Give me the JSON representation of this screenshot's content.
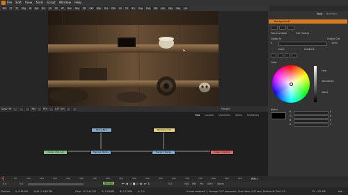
{
  "menu": {
    "items": [
      "File",
      "Edit",
      "View",
      "Tools",
      "Script",
      "Window",
      "Help"
    ]
  },
  "toolbar": {
    "buttons": [
      "BG",
      "FT",
      "TF",
      "Mrg",
      "Bl",
      "Bol",
      "Blr",
      "CC",
      "PE",
      "XF",
      "Rsz",
      "Shp",
      "PM",
      "CW",
      "BSp",
      "Rct",
      "PBL",
      "Ell",
      "Plt",
      "Trk",
      "Rng",
      "Poly",
      "Mft",
      "Vec",
      "Wrp",
      "Bsn",
      "Lin"
    ]
  },
  "viewer_bar": {
    "zoom": "Subv",
    "fit": "Fit",
    "tools": [
      "RoI",
      "ROI",
      "LUT",
      "Sm"
    ],
    "right_label": "Merge1"
  },
  "flow": {
    "tabs": [
      "Flow",
      "Console",
      "Comments",
      "Spline",
      "Keyframes"
    ],
    "nodes": {
      "blur": "Blur1_Blur",
      "background": "Background1",
      "loader": "Loader_shot_1st",
      "merge1": "Merge1_Merge",
      "merge2": "Merge2_Merge",
      "saver": "Saver_out_001"
    }
  },
  "inspector": {
    "title": "Background1",
    "tabs": [
      "Tools",
      "Modifiers"
    ],
    "process_mode_label": "Process Mode",
    "process_mode_value": "Full Frames",
    "global_in_label": "Global In",
    "global_in_value": "0",
    "global_out_label": "Global Out",
    "global_out_value": "1000",
    "color_label": "Color",
    "gradient_label": "Gradient",
    "hue_label": "Hue",
    "saturation_label": "Saturation",
    "value_label": "Value",
    "alpha_label": "Alpha",
    "red_label": "R",
    "green_label": "G",
    "blue_label": "B",
    "alpha_short": "A",
    "channel_values": [
      "0",
      "0",
      "0",
      "1"
    ]
  },
  "timeline": {
    "ticks": [
      "0",
      "50",
      "100",
      "150",
      "200",
      "250",
      "300",
      "350",
      "400",
      "450",
      "500",
      "550",
      "600",
      "650",
      "700",
      "750",
      "800",
      "850",
      "900",
      "950"
    ],
    "end_frame": "1000.0",
    "start": "0.0",
    "start2": "0.0",
    "render_label": "Render",
    "frame_counter": "0.0",
    "hifi_label": "HiQ",
    "mb_label": "MB",
    "prx_label": "Prx",
    "aprx_label": "APrx",
    "some_label": "Some"
  },
  "status": {
    "position_label": "Position",
    "x": "X: 0.82450",
    "y": "Y: 0.61790",
    "pos_extra": "1440",
    "col_label": "Color",
    "r": "R: 0.41135",
    "g": "G: 0.28360",
    "b": "B: 0.17090",
    "a": "A: 1.0",
    "frames_info": "Frames rendered: 1, Average: 3.27 frames/sec, Time taken: 0.31 secs, Finished at: Tue 12:5",
    "mem": "2% - 551 MB",
    "state": "Idle"
  },
  "colors": {
    "accent_orange": "#d67a1f",
    "node_blue": "#7fa8c9",
    "node_yellow": "#e8d37a",
    "node_green": "#8cc28c",
    "node_red": "#d86a6a"
  }
}
